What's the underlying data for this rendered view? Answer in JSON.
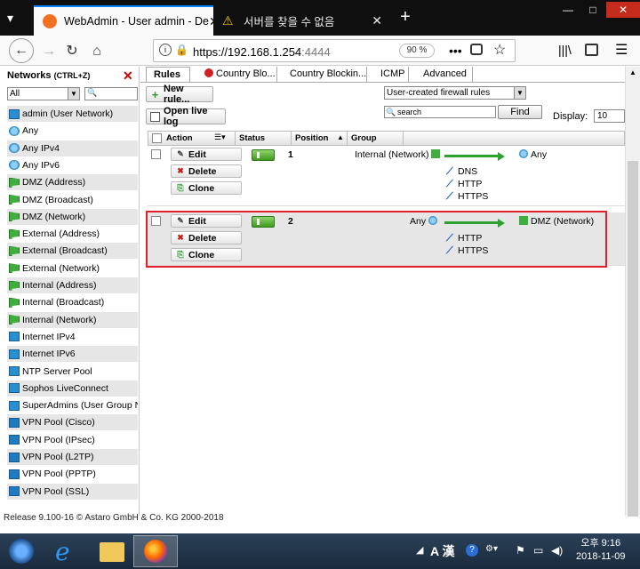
{
  "browser": {
    "tabs": [
      {
        "title": "WebAdmin - User admin - De",
        "active": true
      },
      {
        "title": "서버를 찾을 수 없음",
        "active": false
      }
    ],
    "url_host": "https://192.168.1.254",
    "url_rest": ":4444",
    "zoom": "90 %"
  },
  "networks": {
    "title": "Networks",
    "shortcut": "(CTRL+Z)",
    "filter": "All",
    "items": [
      {
        "label": "admin (User Network)",
        "icon": "network-icon"
      },
      {
        "label": "Any",
        "icon": "globe-icon"
      },
      {
        "label": "Any IPv4",
        "icon": "globe-icon"
      },
      {
        "label": "Any IPv6",
        "icon": "globe-icon"
      },
      {
        "label": "DMZ (Address)",
        "icon": "flag-icon"
      },
      {
        "label": "DMZ (Broadcast)",
        "icon": "flag-icon"
      },
      {
        "label": "DMZ (Network)",
        "icon": "flag-icon"
      },
      {
        "label": "External (Address)",
        "icon": "flag-icon"
      },
      {
        "label": "External (Broadcast)",
        "icon": "flag-icon"
      },
      {
        "label": "External (Network)",
        "icon": "flag-icon"
      },
      {
        "label": "Internal (Address)",
        "icon": "flag-icon"
      },
      {
        "label": "Internal (Broadcast)",
        "icon": "flag-icon"
      },
      {
        "label": "Internal (Network)",
        "icon": "flag-icon"
      },
      {
        "label": "Internet IPv4",
        "icon": "network-icon"
      },
      {
        "label": "Internet IPv6",
        "icon": "network-icon"
      },
      {
        "label": "NTP Server Pool",
        "icon": "network-icon"
      },
      {
        "label": "Sophos LiveConnect",
        "icon": "network-icon"
      },
      {
        "label": "SuperAdmins (User Group Ne",
        "icon": "network-icon"
      },
      {
        "label": "VPN Pool (Cisco)",
        "icon": "vpn-icon"
      },
      {
        "label": "VPN Pool (IPsec)",
        "icon": "vpn-icon"
      },
      {
        "label": "VPN Pool (L2TP)",
        "icon": "vpn-icon"
      },
      {
        "label": "VPN Pool (PPTP)",
        "icon": "vpn-icon"
      },
      {
        "label": "VPN Pool (SSL)",
        "icon": "vpn-icon"
      }
    ]
  },
  "content": {
    "tabs": [
      "Rules",
      "Country Blo...",
      "Country Blockin...",
      "ICMP",
      "Advanced"
    ],
    "new_rule": "New rule...",
    "open_live_log": "Open live log",
    "view_filter": "User-created firewall rules",
    "search_placeholder": "search",
    "find": "Find",
    "display_label": "Display:",
    "display_value": "10",
    "columns": [
      "Action",
      "Status",
      "Position",
      "Group"
    ],
    "row_actions": {
      "edit": "Edit",
      "delete": "Delete",
      "clone": "Clone"
    },
    "rules": [
      {
        "position": "1",
        "source": "Internal (Network)",
        "services": [
          "DNS",
          "HTTP",
          "HTTPS"
        ],
        "destination": "Any",
        "enabled": true
      },
      {
        "position": "2",
        "source": "Any",
        "services": [
          "HTTP",
          "HTTPS"
        ],
        "destination": "DMZ (Network)",
        "enabled": true
      }
    ],
    "release": "Release 9.100-16  © Astaro GmbH & Co. KG 2000-2018"
  },
  "taskbar": {
    "time": "오후 9:16",
    "date": "2018-11-09",
    "ime": "A 漢"
  },
  "colors": {
    "highlight": "#e0202a",
    "accent_green": "#2fa12f",
    "link_blue": "#1f63b8"
  }
}
